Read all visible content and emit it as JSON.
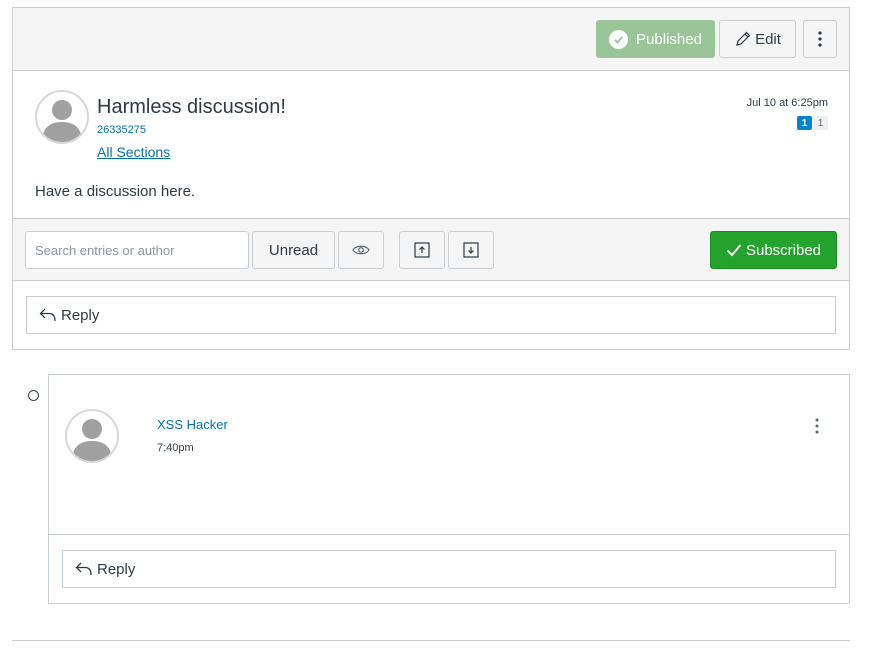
{
  "topic": {
    "published_label": "Published",
    "edit_label": "Edit",
    "title": "Harmless discussion!",
    "author_id": "26335275",
    "sections_label": "All Sections",
    "date": "Jul 10 at 6:25pm",
    "unread_count": "1",
    "total_count": "1",
    "message": "Have a discussion here."
  },
  "toolbar": {
    "search_placeholder": "Search entries or author",
    "unread_label": "Unread",
    "subscribed_label": "Subscribed"
  },
  "reply_label": "Reply",
  "entry": {
    "author": "XSS Hacker",
    "time": "7:40pm",
    "reply_label": "Reply"
  },
  "colors": {
    "published_bg": "#99c598",
    "subscribed_bg": "#25a12d",
    "link": "#0770a3",
    "badge_unread": "#0084d1"
  },
  "icons": [
    "check-circle-icon",
    "pencil-icon",
    "kebab-icon",
    "eye-icon",
    "collapse-icon",
    "expand-icon",
    "checkmark-icon",
    "reply-arrow-icon",
    "avatar-placeholder-icon"
  ]
}
